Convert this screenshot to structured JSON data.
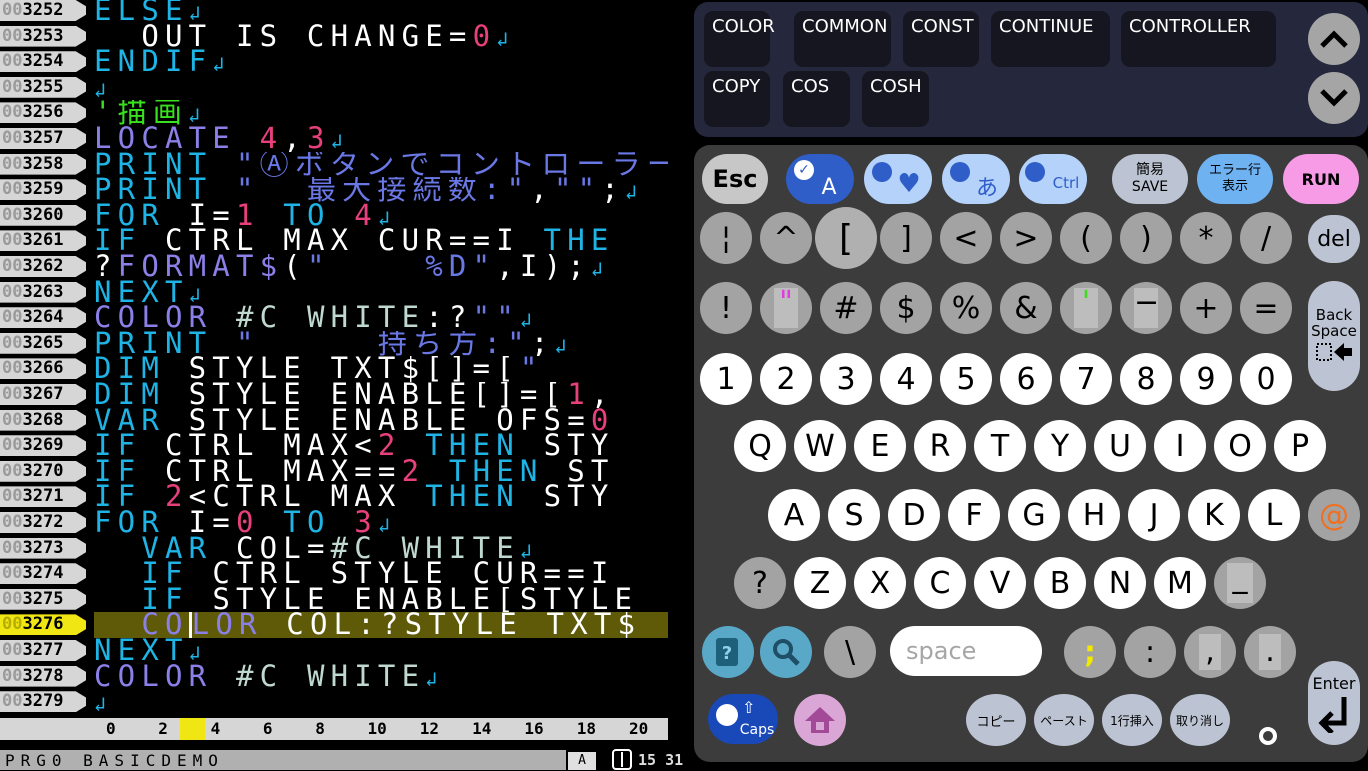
{
  "editor": {
    "lines": [
      {
        "num_zero": "00",
        "num": "3252",
        "tokens": [
          {
            "c": "kw",
            "t": "ELSE"
          },
          {
            "c": "cr",
            "t": "↲"
          }
        ]
      },
      {
        "num_zero": "00",
        "num": "3253",
        "tokens": [
          {
            "c": "",
            "t": "  OUT_IS_CHANGE="
          },
          {
            "c": "num",
            "t": "0"
          },
          {
            "c": "cr",
            "t": "↲"
          }
        ]
      },
      {
        "num_zero": "00",
        "num": "3254",
        "tokens": [
          {
            "c": "kw",
            "t": "ENDIF"
          },
          {
            "c": "cr",
            "t": "↲"
          }
        ]
      },
      {
        "num_zero": "00",
        "num": "3255",
        "tokens": [
          {
            "c": "cr",
            "t": "↲"
          }
        ]
      },
      {
        "num_zero": "00",
        "num": "3256",
        "tokens": [
          {
            "c": "cm",
            "t": "'描画"
          },
          {
            "c": "cr",
            "t": "↲"
          }
        ]
      },
      {
        "num_zero": "00",
        "num": "3257",
        "tokens": [
          {
            "c": "fn",
            "t": "LOCATE "
          },
          {
            "c": "num",
            "t": "4"
          },
          {
            "c": "",
            "t": ","
          },
          {
            "c": "num",
            "t": "3"
          },
          {
            "c": "cr",
            "t": "↲"
          }
        ]
      },
      {
        "num_zero": "00",
        "num": "3258",
        "tokens": [
          {
            "c": "kw",
            "t": "PRINT "
          },
          {
            "c": "str",
            "t": "\"Ⓐボタンでコントローラーの最大"
          }
        ]
      },
      {
        "num_zero": "00",
        "num": "3259",
        "tokens": [
          {
            "c": "kw",
            "t": "PRINT "
          },
          {
            "c": "str",
            "t": "\"  最大接続数:\""
          },
          {
            "c": "",
            "t": ","
          },
          {
            "c": "str",
            "t": "\"\""
          },
          {
            "c": "",
            "t": ";"
          },
          {
            "c": "cr",
            "t": "↲"
          }
        ]
      },
      {
        "num_zero": "00",
        "num": "3260",
        "tokens": [
          {
            "c": "kw",
            "t": "FOR "
          },
          {
            "c": "",
            "t": "I="
          },
          {
            "c": "num",
            "t": "1"
          },
          {
            "c": "kw",
            "t": " TO "
          },
          {
            "c": "num",
            "t": "4"
          },
          {
            "c": "cr",
            "t": "↲"
          }
        ]
      },
      {
        "num_zero": "00",
        "num": "3261",
        "tokens": [
          {
            "c": "kw",
            "t": "IF "
          },
          {
            "c": "",
            "t": "CTRL_MAX_CUR==I "
          },
          {
            "c": "kw",
            "t": "THE"
          }
        ]
      },
      {
        "num_zero": "00",
        "num": "3262",
        "tokens": [
          {
            "c": "",
            "t": "?"
          },
          {
            "c": "fn",
            "t": "FORMAT$"
          },
          {
            "c": "",
            "t": "("
          },
          {
            "c": "str",
            "t": "\"    %D\""
          },
          {
            "c": "",
            "t": ",I);"
          },
          {
            "c": "cr",
            "t": "↲"
          }
        ]
      },
      {
        "num_zero": "00",
        "num": "3263",
        "tokens": [
          {
            "c": "kw",
            "t": "NEXT"
          },
          {
            "c": "cr",
            "t": "↲"
          }
        ]
      },
      {
        "num_zero": "00",
        "num": "3264",
        "tokens": [
          {
            "c": "fn",
            "t": "COLOR "
          },
          {
            "c": "cst",
            "t": "#C_WHITE"
          },
          {
            "c": "",
            "t": ":?"
          },
          {
            "c": "str",
            "t": "\"\""
          },
          {
            "c": "cr",
            "t": "↲"
          }
        ]
      },
      {
        "num_zero": "00",
        "num": "3265",
        "tokens": [
          {
            "c": "kw",
            "t": "PRINT "
          },
          {
            "c": "str",
            "t": "\"     持ち方:\""
          },
          {
            "c": "",
            "t": ";"
          },
          {
            "c": "cr",
            "t": "↲"
          }
        ]
      },
      {
        "num_zero": "00",
        "num": "3266",
        "tokens": [
          {
            "c": "kw",
            "t": "DIM "
          },
          {
            "c": "",
            "t": "STYLE_TXT$[]=["
          },
          {
            "c": "str",
            "t": "\""
          }
        ]
      },
      {
        "num_zero": "00",
        "num": "3267",
        "tokens": [
          {
            "c": "kw",
            "t": "DIM "
          },
          {
            "c": "",
            "t": "STYLE_ENABLE[]=["
          },
          {
            "c": "num",
            "t": "1"
          },
          {
            "c": "",
            "t": ","
          }
        ]
      },
      {
        "num_zero": "00",
        "num": "3268",
        "tokens": [
          {
            "c": "kw",
            "t": "VAR "
          },
          {
            "c": "",
            "t": "STYLE_ENABLE_OFS="
          },
          {
            "c": "num",
            "t": "0"
          }
        ]
      },
      {
        "num_zero": "00",
        "num": "3269",
        "tokens": [
          {
            "c": "kw",
            "t": "IF "
          },
          {
            "c": "",
            "t": "CTRL_MAX<"
          },
          {
            "c": "num",
            "t": "2"
          },
          {
            "c": "kw",
            "t": " THEN "
          },
          {
            "c": "",
            "t": "STY"
          }
        ]
      },
      {
        "num_zero": "00",
        "num": "3270",
        "tokens": [
          {
            "c": "kw",
            "t": "IF "
          },
          {
            "c": "",
            "t": "CTRL_MAX=="
          },
          {
            "c": "num",
            "t": "2"
          },
          {
            "c": "kw",
            "t": " THEN "
          },
          {
            "c": "",
            "t": "ST"
          }
        ]
      },
      {
        "num_zero": "00",
        "num": "3271",
        "tokens": [
          {
            "c": "kw",
            "t": "IF "
          },
          {
            "c": "num",
            "t": "2"
          },
          {
            "c": "",
            "t": "<CTRL_MAX "
          },
          {
            "c": "kw",
            "t": "THEN "
          },
          {
            "c": "",
            "t": "STY"
          }
        ]
      },
      {
        "num_zero": "00",
        "num": "3272",
        "tokens": [
          {
            "c": "kw",
            "t": "FOR "
          },
          {
            "c": "",
            "t": "I="
          },
          {
            "c": "num",
            "t": "0"
          },
          {
            "c": "kw",
            "t": " TO "
          },
          {
            "c": "num",
            "t": "3"
          },
          {
            "c": "cr",
            "t": "↲"
          }
        ]
      },
      {
        "num_zero": "00",
        "num": "3273",
        "tokens": [
          {
            "c": "kw",
            "t": "  VAR "
          },
          {
            "c": "",
            "t": "COL="
          },
          {
            "c": "cst",
            "t": "#C_WHITE"
          },
          {
            "c": "cr",
            "t": "↲"
          }
        ]
      },
      {
        "num_zero": "00",
        "num": "3274",
        "tokens": [
          {
            "c": "kw",
            "t": "  IF "
          },
          {
            "c": "",
            "t": "CTRL_STYLE_CUR==I"
          }
        ]
      },
      {
        "num_zero": "00",
        "num": "3275",
        "tokens": [
          {
            "c": "kw",
            "t": "  IF "
          },
          {
            "c": "",
            "t": "STYLE_ENABLE[STYLE"
          }
        ]
      },
      {
        "num_zero": "00",
        "num": "3276",
        "current": true,
        "tokens": [
          {
            "c": "fn",
            "t": "  CO"
          },
          {
            "c": "fn caret",
            "t": "L"
          },
          {
            "c": "fn",
            "t": "OR "
          },
          {
            "c": "",
            "t": "COL:?STYLE_TXT$"
          }
        ]
      },
      {
        "num_zero": "00",
        "num": "3277",
        "tokens": [
          {
            "c": "kw",
            "t": "NEXT"
          },
          {
            "c": "cr",
            "t": "↲"
          }
        ]
      },
      {
        "num_zero": "00",
        "num": "3278",
        "tokens": [
          {
            "c": "fn",
            "t": "COLOR "
          },
          {
            "c": "cst",
            "t": "#C_WHITE"
          },
          {
            "c": "cr",
            "t": "↲"
          }
        ]
      },
      {
        "num_zero": "00",
        "num": "3279",
        "tokens": [
          {
            "c": "cr",
            "t": "↲"
          }
        ]
      }
    ]
  },
  "ruler": {
    "ticks": [
      "0",
      "2",
      "4",
      "6",
      "8",
      "10",
      "12",
      "14",
      "16",
      "18",
      "20"
    ],
    "cursor_column": 3
  },
  "status": {
    "program": "PRG0 BASICDEMO",
    "ime": "A",
    "controller_icon": "joycon-icon",
    "time": "15 31"
  },
  "suggestions": {
    "row1": [
      "COLOR",
      "COMMON",
      "CONST",
      "CONTINUE",
      "CONTROLLER"
    ],
    "row2": [
      "COPY",
      "COS",
      "COSH"
    ],
    "scroll_up": "chevron-up-icon",
    "scroll_down": "chevron-down-icon"
  },
  "keyboard": {
    "top_row": {
      "esc": "Esc",
      "alpha": "A",
      "symbol": "♥",
      "kana": "あ",
      "ctrl": "Ctrl",
      "save_line1": "簡易",
      "save_line2": "SAVE",
      "err_line1": "エラー行",
      "err_line2": "表示",
      "run": "RUN"
    },
    "sym_row1": [
      "¦",
      "^",
      "[",
      "]",
      "<",
      ">",
      "(",
      ")",
      "*",
      "/"
    ],
    "del": "del",
    "sym_row2": [
      "!",
      "\"",
      "#",
      "$",
      "%",
      "&",
      "'",
      "−",
      "+",
      "="
    ],
    "backspace_line1": "Back",
    "backspace_line2": "Space",
    "digits": [
      "1",
      "2",
      "3",
      "4",
      "5",
      "6",
      "7",
      "8",
      "9",
      "0"
    ],
    "row_q": [
      "Q",
      "W",
      "E",
      "R",
      "T",
      "Y",
      "U",
      "I",
      "O",
      "P"
    ],
    "row_a": [
      "A",
      "S",
      "D",
      "F",
      "G",
      "H",
      "J",
      "K",
      "L"
    ],
    "at": "@",
    "question": "?",
    "row_z": [
      "Z",
      "X",
      "C",
      "V",
      "B",
      "N",
      "M"
    ],
    "underscore": "_",
    "backslash": "\\",
    "space": "space",
    "punct": [
      ";",
      ":",
      ",",
      "."
    ],
    "enter": "Enter",
    "caps": "Caps",
    "copy": "コピー",
    "paste": "ペースト",
    "insert_line": "1行挿入",
    "undo": "取り消し"
  },
  "colors": {
    "keyword": "#1fb4e6",
    "function": "#8b7fe8",
    "number": "#e8407c",
    "string": "#6a78e6",
    "comment": "#39e01e",
    "run": "#f79be6",
    "current_line": "#5e5a08"
  }
}
